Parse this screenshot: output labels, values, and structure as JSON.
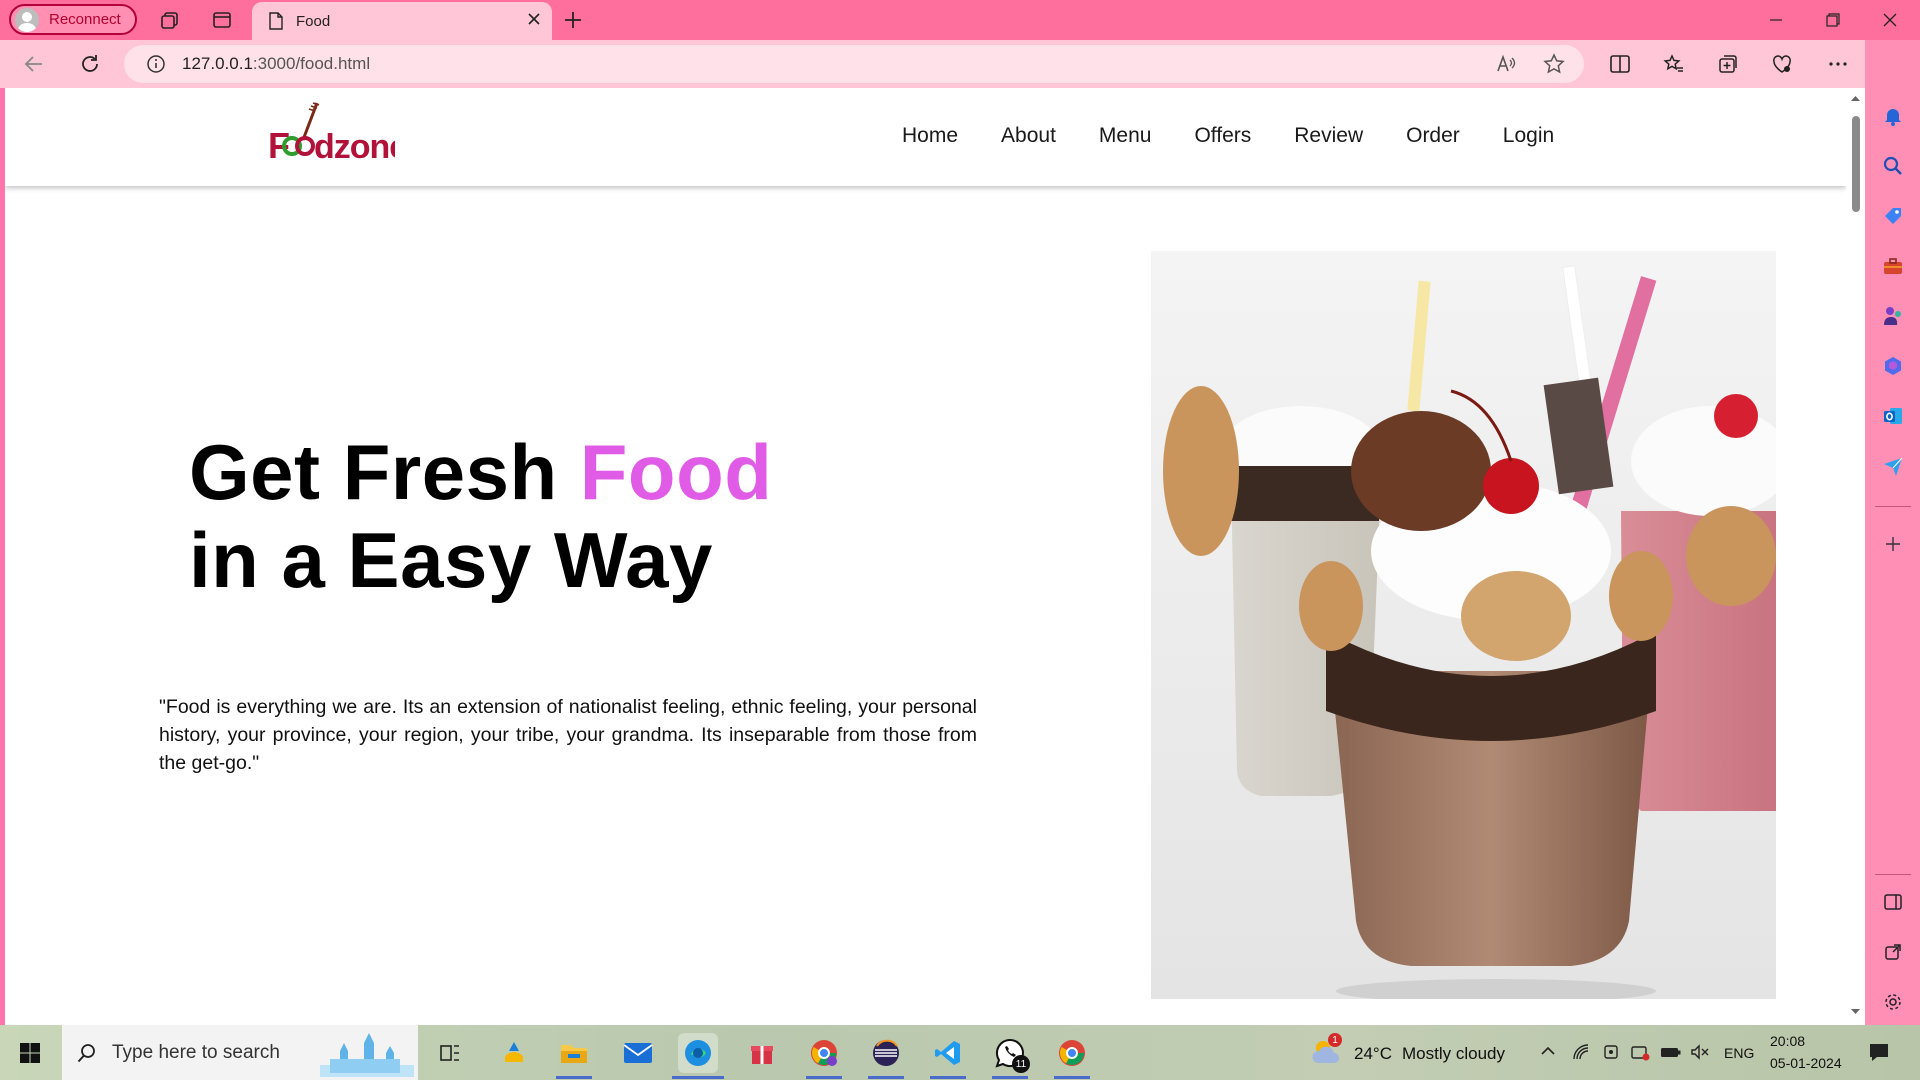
{
  "browser": {
    "profile_label": "Reconnect",
    "tab_title": "Food",
    "url_host": "127.0.0.1",
    "url_path": ":3000/food.html"
  },
  "site": {
    "logo_text": "Foodzone",
    "nav": [
      "Home",
      "About",
      "Menu",
      "Offers",
      "Review",
      "Order",
      "Login"
    ],
    "hero_line1": "Get Fresh ",
    "hero_highlight": "Food",
    "hero_line2": "in a Easy Way",
    "quote": "\"Food is everything we are. Its an extension of nationalist feeling, ethnic feeling, your personal history, your province, your region, your tribe, your grandma. Its inseparable from those from the get-go.\"",
    "colors": {
      "accent": "#e05ce6",
      "header_bg": "#ffffff",
      "logo_red": "#b0123a",
      "logo_green": "#2e9d2e"
    }
  },
  "taskbar": {
    "search_placeholder": "Type here to search",
    "weather_temp": "24°C",
    "weather_text": "Mostly cloudy",
    "language": "ENG",
    "time": "20:08",
    "date": "05-01-2024",
    "weather_badge": "1",
    "whatsapp_badge": "11"
  },
  "theme": {
    "chrome": "#ff6f9e",
    "chrome_light": "#ffc6d8"
  }
}
